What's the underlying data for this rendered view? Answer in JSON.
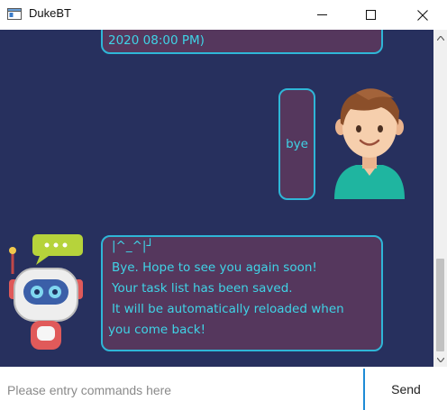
{
  "window": {
    "title": "DukeBT"
  },
  "icons": {
    "app": "app-window-icon",
    "minimize": "minimize-icon",
    "maximize": "maximize-icon",
    "close": "close-icon",
    "scroll_up": "scroll-up-arrow-icon",
    "scroll_down": "scroll-down-arrow-icon",
    "user_avatar": "user-avatar-icon",
    "bot_avatar": "robot-avatar-icon"
  },
  "colors": {
    "chat_background": "#27305e",
    "bubble_fill": "#55375d",
    "bubble_border": "#2fb6d7",
    "bubble_text": "#3fd3e6",
    "send_accent": "#1e8bd6"
  },
  "messages": [
    {
      "sender": "bot",
      "lines": [
        "2020 08:00 PM)"
      ]
    },
    {
      "sender": "user",
      "lines": [
        "bye"
      ]
    },
    {
      "sender": "bot",
      "lines": [
        "|^_^|┘",
        "Bye. Hope to see you again soon!",
        "Your task list has been saved.",
        "It will be automatically reloaded when",
        "you come back!"
      ]
    }
  ],
  "input": {
    "placeholder": "Please entry commands here",
    "value": ""
  },
  "send": {
    "label": "Send"
  }
}
